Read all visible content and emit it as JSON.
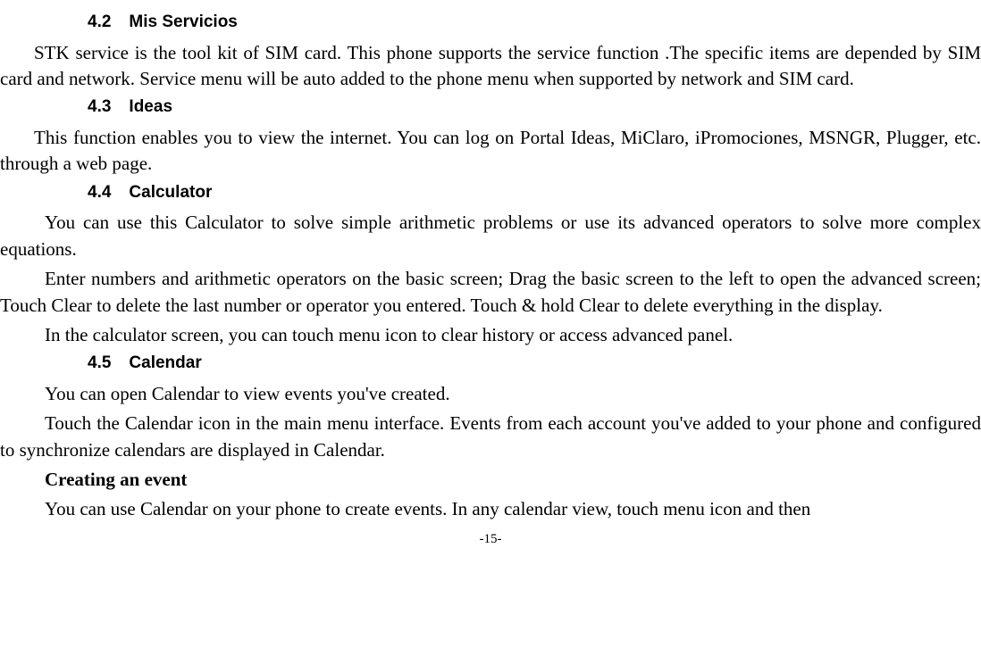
{
  "sections": {
    "s42": {
      "num": "4.2",
      "title": "Mis Servicios",
      "para1": "STK service is the tool kit of SIM card. This phone supports the service function .The specific items are depended by SIM card and network. Service menu will be auto added to the phone menu when supported by network and SIM card."
    },
    "s43": {
      "num": "4.3",
      "title": "Ideas",
      "para1": "This function enables you to view the internet. You can log on Portal Ideas, MiClaro, iPromociones, MSNGR, Plugger, etc. through a web page."
    },
    "s44": {
      "num": "4.4",
      "title": "Calculator",
      "para1": "You can use this Calculator to solve simple arithmetic problems or use its advanced operators to solve more complex equations.",
      "para2": "Enter numbers and arithmetic operators on the basic screen; Drag the basic screen to the left to open the advanced screen; Touch Clear to delete the last number or operator you entered. Touch & hold Clear to delete everything in the display.",
      "para3": "In the calculator screen, you can touch menu icon to clear history or access advanced panel."
    },
    "s45": {
      "num": "4.5",
      "title": "Calendar",
      "para1": "You can open Calendar to view events you've created.",
      "para2": "Touch the Calendar icon in the main menu interface. Events from each account you've added to your phone and configured to synchronize calendars are displayed in Calendar.",
      "subheading": "Creating an event",
      "para3": "You can use Calendar on your phone to create events. In any calendar view, touch menu icon and then"
    }
  },
  "pageNumber": "-15-"
}
